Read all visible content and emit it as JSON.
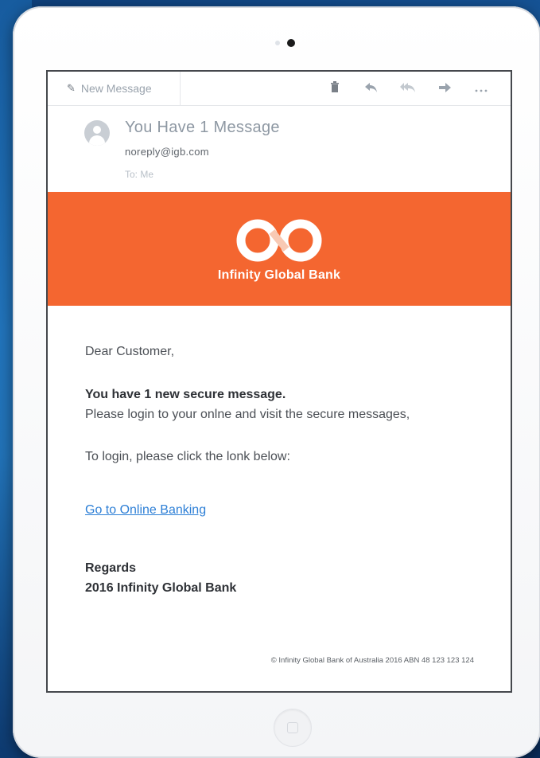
{
  "toolbar": {
    "new_message_label": "New Message",
    "icons": [
      "pencil-icon",
      "trash-icon",
      "reply-icon",
      "reply-all-icon",
      "forward-icon",
      "more-icon"
    ]
  },
  "email": {
    "subject": "You Have 1 Message",
    "sender": "noreply@igb.com",
    "to": "To: Me"
  },
  "banner": {
    "brand_name": "Infinity Global Bank",
    "color": "#f46630"
  },
  "body": {
    "greeting": "Dear Customer,",
    "headline": "You have 1 new secure message.",
    "line1": "Please login to your onlne and visit the secure messages,",
    "line2": "To login, please click the lonk below:",
    "link_text": "Go to Online Banking",
    "regards": "Regards",
    "signature": "2016 Infinity Global Bank",
    "footer": "© Infinity Global Bank of Australia 2016 ABN 48 123 123 124"
  },
  "colors": {
    "link": "#2d7fd6",
    "accent": "#f46630",
    "background": "#1a5fa6"
  }
}
